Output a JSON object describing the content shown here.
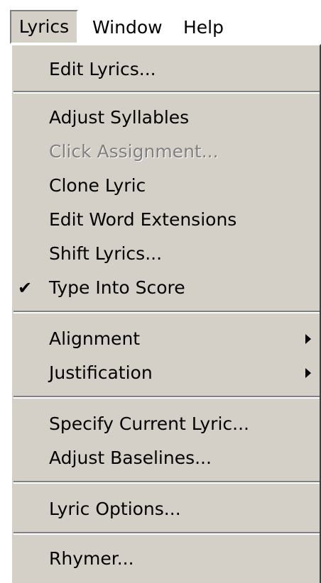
{
  "menubar": {
    "items": [
      {
        "label": "Lyrics"
      },
      {
        "label": "Window"
      },
      {
        "label": "Help"
      }
    ]
  },
  "menu": {
    "items": [
      {
        "label": "Edit Lyrics..."
      },
      {
        "label": "Adjust Syllables"
      },
      {
        "label": "Click Assignment..."
      },
      {
        "label": "Clone Lyric"
      },
      {
        "label": "Edit Word Extensions"
      },
      {
        "label": "Shift Lyrics..."
      },
      {
        "label": "Type Into Score",
        "check": "✔"
      },
      {
        "label": "Alignment"
      },
      {
        "label": "Justification"
      },
      {
        "label": "Specify Current Lyric..."
      },
      {
        "label": "Adjust Baselines..."
      },
      {
        "label": "Lyric Options..."
      },
      {
        "label": "Rhymer..."
      }
    ]
  }
}
